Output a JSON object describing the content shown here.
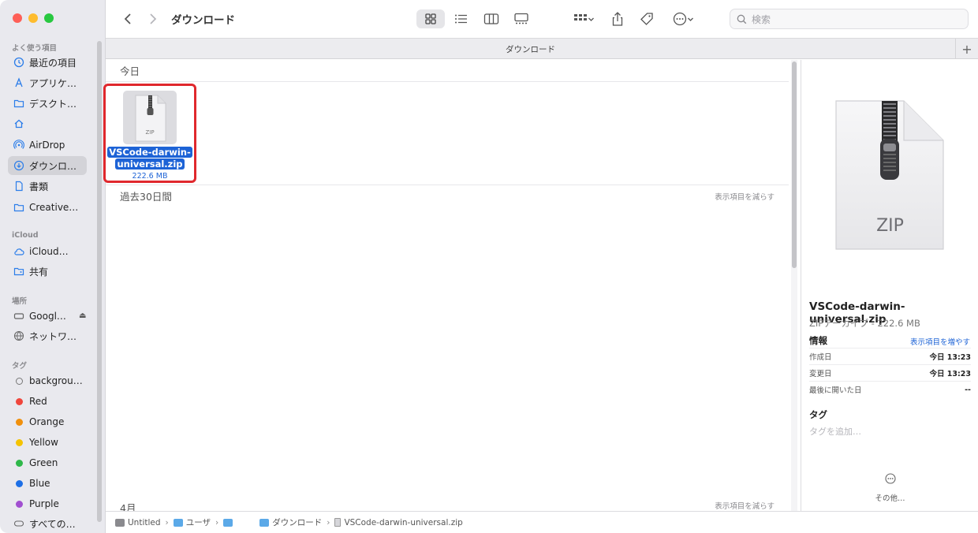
{
  "window": {
    "title": "ダウンロード"
  },
  "colors": {
    "accent": "#1d63d6",
    "highlight_border": "#e0282d"
  },
  "sidebar": {
    "sections": [
      {
        "label": "よく使う項目",
        "items": [
          {
            "label": "最近の項目",
            "icon": "clock-icon"
          },
          {
            "label": "アプリケ…",
            "icon": "applications-icon"
          },
          {
            "label": "デスクト…",
            "icon": "folder-icon"
          },
          {
            "label": "",
            "icon": "home-icon"
          },
          {
            "label": "AirDrop",
            "icon": "airdrop-icon"
          },
          {
            "label": "ダウンロ…",
            "icon": "downloads-icon",
            "active": true
          },
          {
            "label": "書類",
            "icon": "document-icon"
          },
          {
            "label": "Creative…",
            "icon": "folder-icon"
          }
        ]
      },
      {
        "label": "iCloud",
        "items": [
          {
            "label": "iCloud…",
            "icon": "cloud-icon"
          },
          {
            "label": "共有",
            "icon": "shared-folder-icon"
          }
        ]
      },
      {
        "label": "場所",
        "items": [
          {
            "label": "Googl…",
            "icon": "drive-icon",
            "eject": true
          },
          {
            "label": "ネットワ…",
            "icon": "network-icon"
          }
        ]
      },
      {
        "label": "タグ",
        "items": [
          {
            "label": "backgrou…",
            "tag_color": ""
          },
          {
            "label": "Red",
            "tag_color": "#f0463c"
          },
          {
            "label": "Orange",
            "tag_color": "#f0900c"
          },
          {
            "label": "Yellow",
            "tag_color": "#f5c300"
          },
          {
            "label": "Green",
            "tag_color": "#2fb84a"
          },
          {
            "label": "Blue",
            "tag_color": "#1d6fe6"
          },
          {
            "label": "Purple",
            "tag_color": "#a14fd0"
          },
          {
            "label": "すべての…",
            "icon": "all-tags-icon"
          }
        ]
      }
    ]
  },
  "toolbar": {
    "title": "ダウンロード",
    "search_placeholder": "検索"
  },
  "tabbar": {
    "label": "ダウンロード",
    "add": "+"
  },
  "content": {
    "groups": [
      {
        "title": "今日",
        "sub": ""
      },
      {
        "title": "過去30日間",
        "sub": "表示項目を減らす"
      },
      {
        "title": "4月",
        "sub": "表示項目を減らす"
      }
    ],
    "file": {
      "name_line1": "VSCode-darwin-",
      "name_line2": "universal.zip",
      "size": "222.6 MB",
      "thumb_label": "ZIP"
    }
  },
  "preview": {
    "icon_label": "ZIP",
    "name": "VSCode-darwin-universal.zip",
    "kind": "ZIPアーカイブ - 222.6 MB",
    "info_header": "情報",
    "show_more": "表示項目を増やす",
    "rows": [
      {
        "label": "作成日",
        "value": "今日 13:23"
      },
      {
        "label": "変更日",
        "value": "今日 13:23"
      },
      {
        "label": "最後に開いた日",
        "value": "--"
      }
    ],
    "tags_header": "タグ",
    "tags_placeholder": "タグを追加…",
    "other": "その他…"
  },
  "pathbar": {
    "crumbs": [
      "Untitled",
      "ユーザ",
      "",
      "ダウンロード",
      "VSCode-darwin-universal.zip"
    ]
  }
}
